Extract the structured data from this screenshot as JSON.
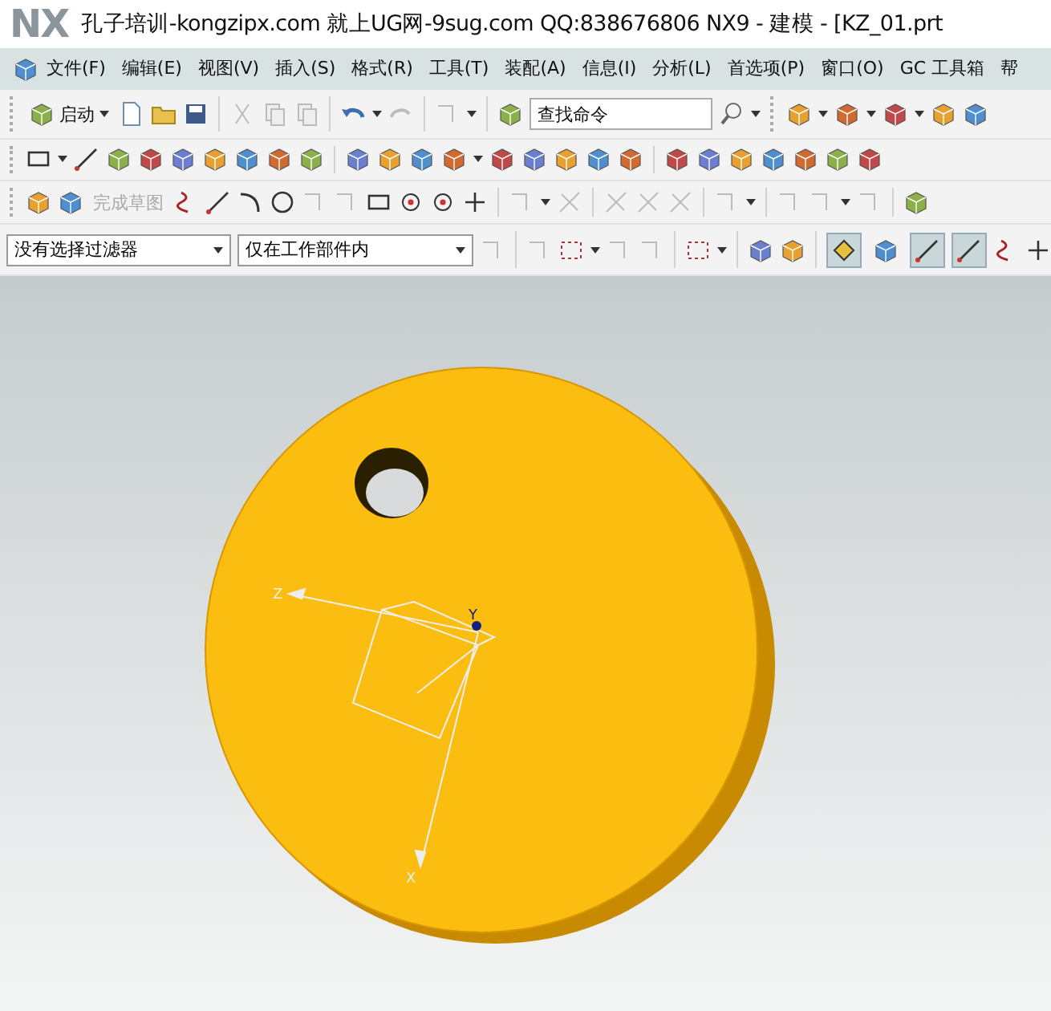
{
  "window": {
    "logo": "NX",
    "title": "孔子培训-kongzipx.com 就上UG网-9sug.com QQ:838676806 NX9 - 建模 - [KZ_01.prt"
  },
  "menu_bar": {
    "items": [
      "文件(F)",
      "编辑(E)",
      "视图(V)",
      "插入(S)",
      "格式(R)",
      "工具(T)",
      "装配(A)",
      "信息(I)",
      "分析(L)",
      "首选项(P)",
      "窗口(O)",
      "GC 工具箱",
      "帮"
    ]
  },
  "standard_toolbar": {
    "start_button": "启动",
    "search": {
      "placeholder": "查找命令"
    }
  },
  "sketch_toolbar": {
    "finish_sketch": {
      "label": "完成草图",
      "disabled": true
    }
  },
  "selection_bar": {
    "filter": "没有选择过滤器",
    "scope": "仅在工作部件内",
    "toggles": [
      {
        "on": true
      },
      {
        "on": false
      },
      {
        "on": true
      },
      {
        "on": true
      }
    ]
  },
  "graphics": {
    "axis_labels": [
      "Z",
      "Y",
      "X"
    ]
  }
}
